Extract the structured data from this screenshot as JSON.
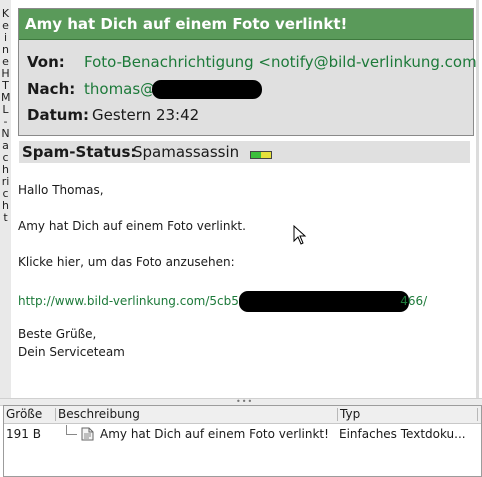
{
  "sidebar": {
    "vertical_label": "Keine HTML-Nachricht"
  },
  "header": {
    "subject": "Amy hat Dich auf einem Foto verlinkt!",
    "from_label": "Von:",
    "from_value": "Foto-Benachrichtigung <notify@bild-verlinkung.com>",
    "to_label": "Nach:",
    "to_value": "thomas@",
    "date_label": "Datum:",
    "date_value": "Gestern 23:42"
  },
  "spam": {
    "label": "Spam-Status:",
    "value": "Spamassassin",
    "meter_color_low": "#3bbf3b",
    "meter_color_mid": "#e6e23b"
  },
  "body": {
    "greeting": "Hallo Thomas,",
    "line1": "Amy hat Dich auf einem Foto verlinkt.",
    "line2": "Klicke hier, um das Foto anzusehen:",
    "link_start": "http://www.bild-verlinkung.com/5cb5a",
    "link_end": "466/",
    "closing1": "Beste Grüße,",
    "closing2": "Dein Serviceteam"
  },
  "attachments": {
    "columns": {
      "size": "Größe",
      "description": "Beschreibung",
      "type": "Typ"
    },
    "rows": [
      {
        "size": "191 B",
        "description": "Amy hat Dich auf einem Foto verlinkt!",
        "type": "Einfaches Textdoku..."
      }
    ]
  },
  "colors": {
    "subject_bg": "#5a9a5a",
    "link": "#1d7a3a",
    "header_bg": "#e0e0e0"
  }
}
